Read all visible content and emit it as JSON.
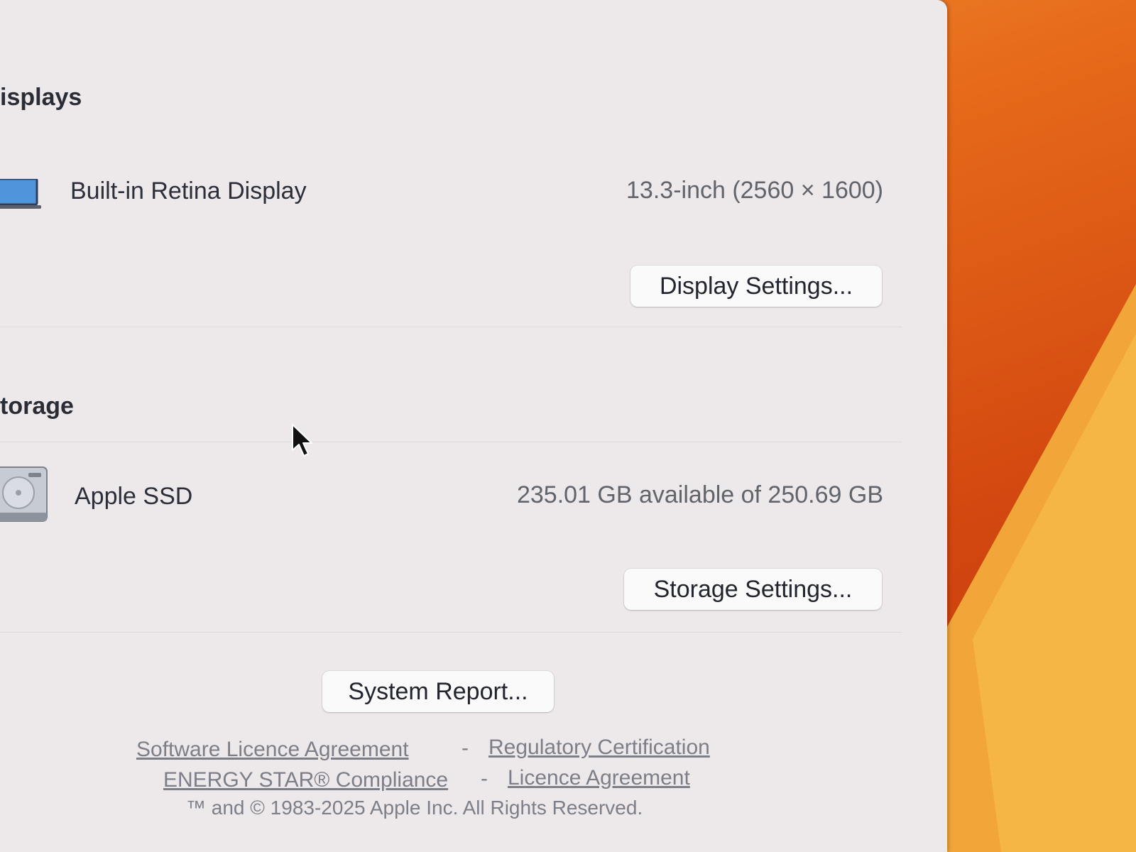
{
  "displays": {
    "heading": "isplays",
    "item_name": "Built-in Retina Display",
    "item_spec": "13.3-inch (2560 × 1600)",
    "settings_button": "Display Settings..."
  },
  "storage": {
    "heading": "torage",
    "item_name": "Apple SSD",
    "item_spec": "235.01 GB available of 250.69 GB",
    "settings_button": "Storage Settings..."
  },
  "system_report_button": "System Report...",
  "footer": {
    "links_row1": [
      "Software Licence Agreement",
      "Regulatory Certification"
    ],
    "links_row2": [
      "ENERGY STAR® Compliance",
      "Licence Agreement"
    ],
    "separator": "-",
    "copyright": "™ and © 1983-2025 Apple Inc. All Rights Reserved."
  },
  "colors": {
    "window_bg": "#ede9ea",
    "wallpaper_orange": "#e66a1a",
    "wallpaper_yellow": "#f5b038"
  },
  "icons": [
    "laptop-display-icon",
    "hard-drive-icon",
    "mouse-pointer-icon"
  ]
}
